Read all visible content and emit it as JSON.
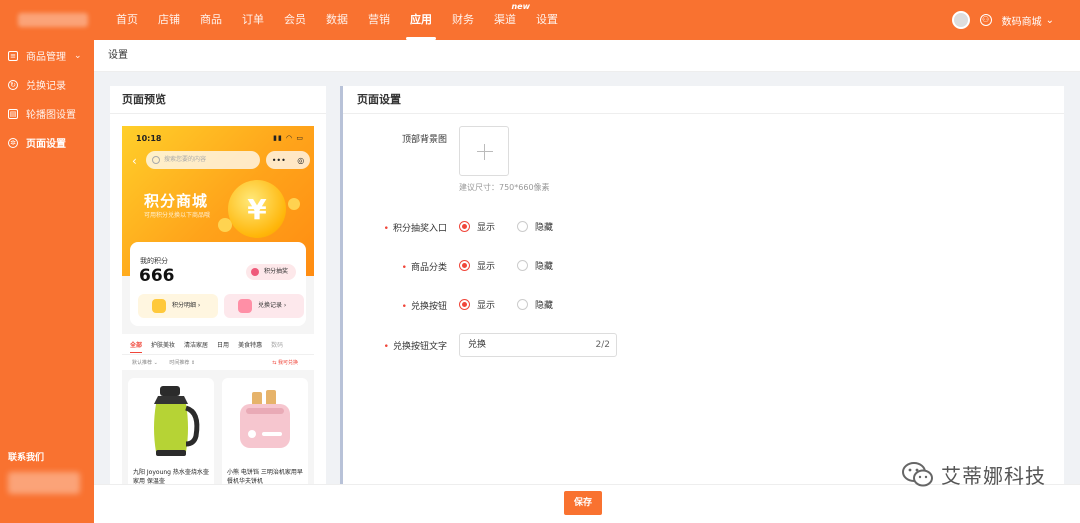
{
  "colors": {
    "brand": "#f97230",
    "accent_red": "#f0463a"
  },
  "topnav": {
    "items": [
      "首页",
      "店铺",
      "商品",
      "订单",
      "会员",
      "数据",
      "营销",
      "应用",
      "财务",
      "渠道",
      "设置"
    ],
    "new_badge": "new",
    "user_name": "数码商城"
  },
  "sidebar": {
    "items": [
      {
        "label": "商品管理",
        "icon": "goods-icon"
      },
      {
        "label": "兑换记录",
        "icon": "record-icon"
      },
      {
        "label": "轮播图设置",
        "icon": "carousel-icon"
      },
      {
        "label": "页面设置",
        "icon": "gear-icon"
      }
    ],
    "contact": "联系我们"
  },
  "breadcrumb": "设置",
  "preview": {
    "title": "页面预览",
    "phone": {
      "time": "10:18",
      "search_placeholder": "搜索您要的内容",
      "capsule_dots": "•••",
      "capsule_target": "◎",
      "mall_title": "积分商城",
      "mall_sub": "可用积分兑换以下商品哦",
      "coin_symbol": "¥",
      "points_label": "我的积分",
      "points_value": "666",
      "lottery": "积分抽奖",
      "btn_details": "积分明细 ›",
      "btn_records": "兑换记录 ›",
      "tabs": [
        "全部",
        "护肤美妆",
        "清洁家居",
        "日用",
        "美食特惠",
        "数码"
      ],
      "sort": [
        "默认推荐 ⌄",
        "时间推荐 ⇕"
      ],
      "can_exchange": "⇆ 我可兑换",
      "products": [
        {
          "name": "九阳 Joyoung 热水壶烧水壶家用 保温壶"
        },
        {
          "name": "小熊 电饼铛 三明治机家用早餐机华夫饼机"
        }
      ]
    }
  },
  "settings": {
    "title": "页面设置",
    "bg_label": "顶部背景图",
    "bg_hint": "建议尺寸：750*660像素",
    "rows": [
      {
        "label": "积分抽奖入口",
        "show": "显示",
        "hide": "隐藏"
      },
      {
        "label": "商品分类",
        "show": "显示",
        "hide": "隐藏"
      },
      {
        "label": "兑换按钮",
        "show": "显示",
        "hide": "隐藏"
      }
    ],
    "text_label": "兑换按钮文字",
    "text_value": "兑换",
    "text_counter": "2/2",
    "required_mark": "•"
  },
  "footer": {
    "save": "保存"
  },
  "watermark": {
    "text": "艾蒂娜科技",
    "icon": "wechat-icon"
  }
}
